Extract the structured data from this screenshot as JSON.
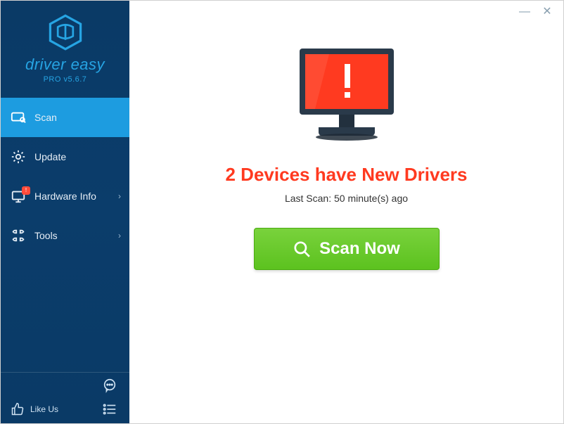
{
  "brand": {
    "name": "driver easy",
    "version_label": "PRO v5.6.7"
  },
  "sidebar": {
    "items": [
      {
        "label": "Scan"
      },
      {
        "label": "Update"
      },
      {
        "label": "Hardware Info"
      },
      {
        "label": "Tools"
      }
    ],
    "like_label": "Like Us"
  },
  "main": {
    "status_title": "2 Devices have New Drivers",
    "status_sub": "Last Scan: 50 minute(s) ago",
    "scan_button": "Scan Now"
  }
}
